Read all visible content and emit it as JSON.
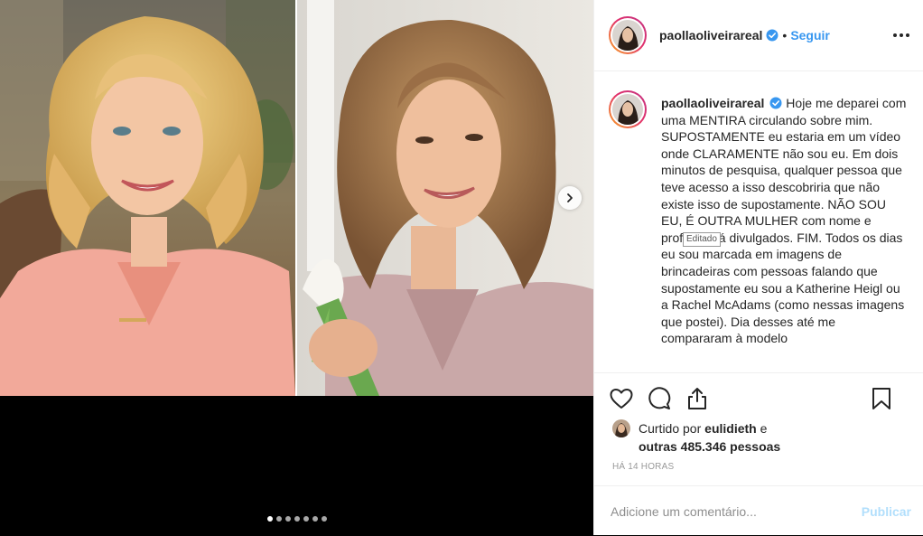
{
  "post": {
    "username": "paollaoliveirareal",
    "follow_label": "Seguir",
    "separator": "•",
    "caption": "Hoje me deparei com uma MENTIRA circulando sobre mim. SUPOSTAMENTE eu estaria em um vídeo onde CLARAMENTE não sou eu. Em dois minutos de pesquisa, qualquer pessoa que teve acesso a isso descobriria que não existe isso de supostamente. NÃO SOU EU, É OUTRA MULHER com nome e profissão já divulgados. FIM. Todos os dias eu sou marcada em imagens de brincadeiras com pessoas falando que supostamente eu sou a Katherine Heigl ou a Rachel McAdams (como nessas imagens que postei). Dia desses até me compararam à modelo",
    "edited_badge": "Editado",
    "liked_by_prefix": "Curtido por",
    "liked_by_user": "eulidieth",
    "liked_by_conj": "e",
    "likes_others": "outras 485.346 pessoas",
    "timestamp": "HÁ 14 HORAS"
  },
  "comment": {
    "placeholder": "Adicione um comentário...",
    "publish_label": "Publicar"
  },
  "carousel": {
    "slide_count": 7,
    "active_index": 0
  },
  "colors": {
    "link_blue": "#3897f0",
    "publish_disabled": "#b2dffc",
    "verified_blue": "#3897f0",
    "divider": "#efefef"
  },
  "icons": [
    "verified-badge-icon",
    "more-options-icon",
    "heart-icon",
    "comment-icon",
    "share-icon",
    "bookmark-icon",
    "chevron-right-icon"
  ]
}
